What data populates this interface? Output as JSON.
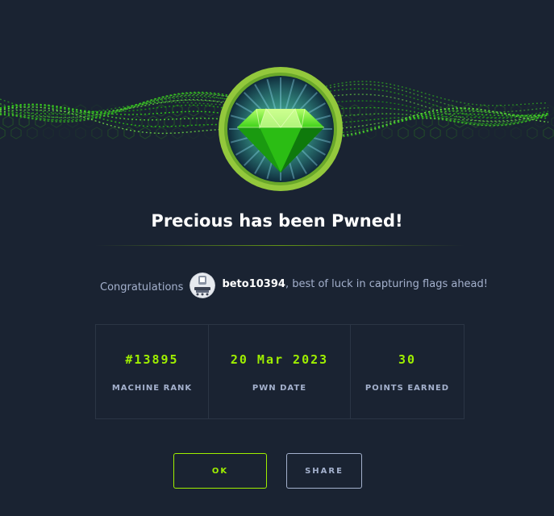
{
  "modal": {
    "title": "Precious has been Pwned!",
    "congrats_lead": "Congratulations",
    "username": "beto10394",
    "congrats_tail": ", best of luck in capturing flags ahead!",
    "stats": [
      {
        "value": "#13895",
        "label": "MACHINE RANK"
      },
      {
        "value": "20 Mar 2023",
        "label": "PWN DATE"
      },
      {
        "value": "30",
        "label": "POINTS EARNED"
      }
    ],
    "buttons": {
      "ok": "OK",
      "share": "SHARE"
    },
    "icons": {
      "badge": "green-gem-icon",
      "avatar": "user-avatar"
    }
  },
  "colors": {
    "background": "#1a2332",
    "accent": "#9fef00",
    "muted_text": "#a4b1cd",
    "heading": "#ffffff",
    "panel_border": "#2b3545"
  }
}
